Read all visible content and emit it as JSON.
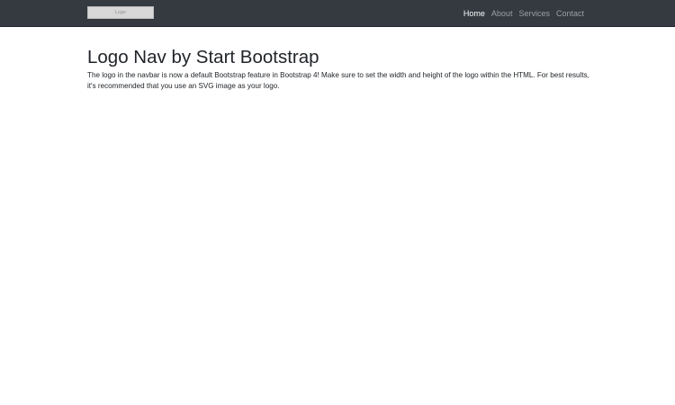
{
  "navbar": {
    "logo_text": "Logo",
    "links": [
      {
        "label": "Home",
        "active": true
      },
      {
        "label": "About",
        "active": false
      },
      {
        "label": "Services",
        "active": false
      },
      {
        "label": "Contact",
        "active": false
      }
    ]
  },
  "main": {
    "title": "Logo Nav by Start Bootstrap",
    "text": "The logo in the navbar is now a default Bootstrap feature in Bootstrap 4! Make sure to set the width and height of the logo within the HTML. For best results, it's recommended that you use an SVG image as your logo."
  },
  "colors": {
    "navbar_bg": "#343a40",
    "nav_active": "#ffffff",
    "nav_inactive": "#9aa0a6",
    "text": "#212529"
  }
}
